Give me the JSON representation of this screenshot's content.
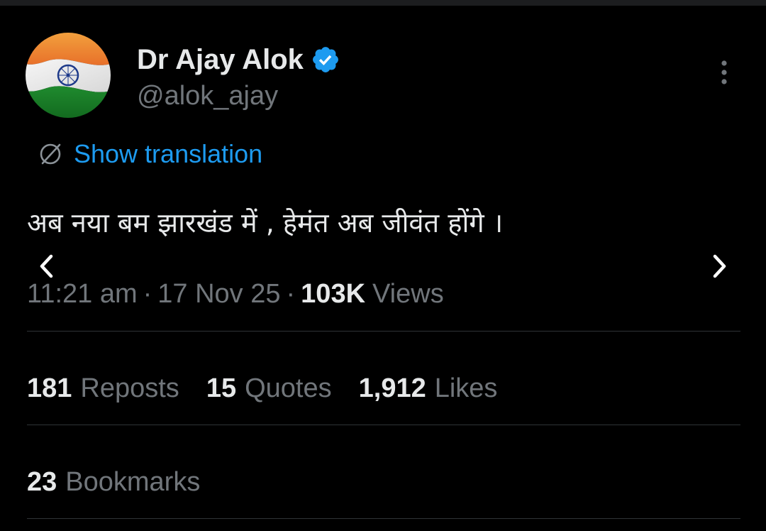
{
  "author": {
    "display_name": "Dr Ajay Alok",
    "handle": "@alok_ajay",
    "avatar": "india-flag",
    "verified": true
  },
  "translation": {
    "label": "Show translation",
    "icon": "globe-icon"
  },
  "tweet": {
    "text": "अब नया बम झारखंड में , हेमंत अब जीवंत होंगे ।",
    "time": "11:21 am",
    "date": "17 Nov 25",
    "views_count": "103K",
    "views_label": "Views"
  },
  "stats": {
    "reposts": {
      "count": "181",
      "label": "Reposts"
    },
    "quotes": {
      "count": "15",
      "label": "Quotes"
    },
    "likes": {
      "count": "1,912",
      "label": "Likes"
    },
    "bookmarks": {
      "count": "23",
      "label": "Bookmarks"
    }
  },
  "colors": {
    "background": "#000000",
    "text": "#e7e9ea",
    "muted": "#71767b",
    "accent": "#1d9bf0",
    "divider": "#2f3336"
  },
  "icons": {
    "verified": "verified-badge-icon",
    "more": "more-vertical-icon",
    "prev": "chevron-left-icon",
    "next": "chevron-right-icon"
  }
}
